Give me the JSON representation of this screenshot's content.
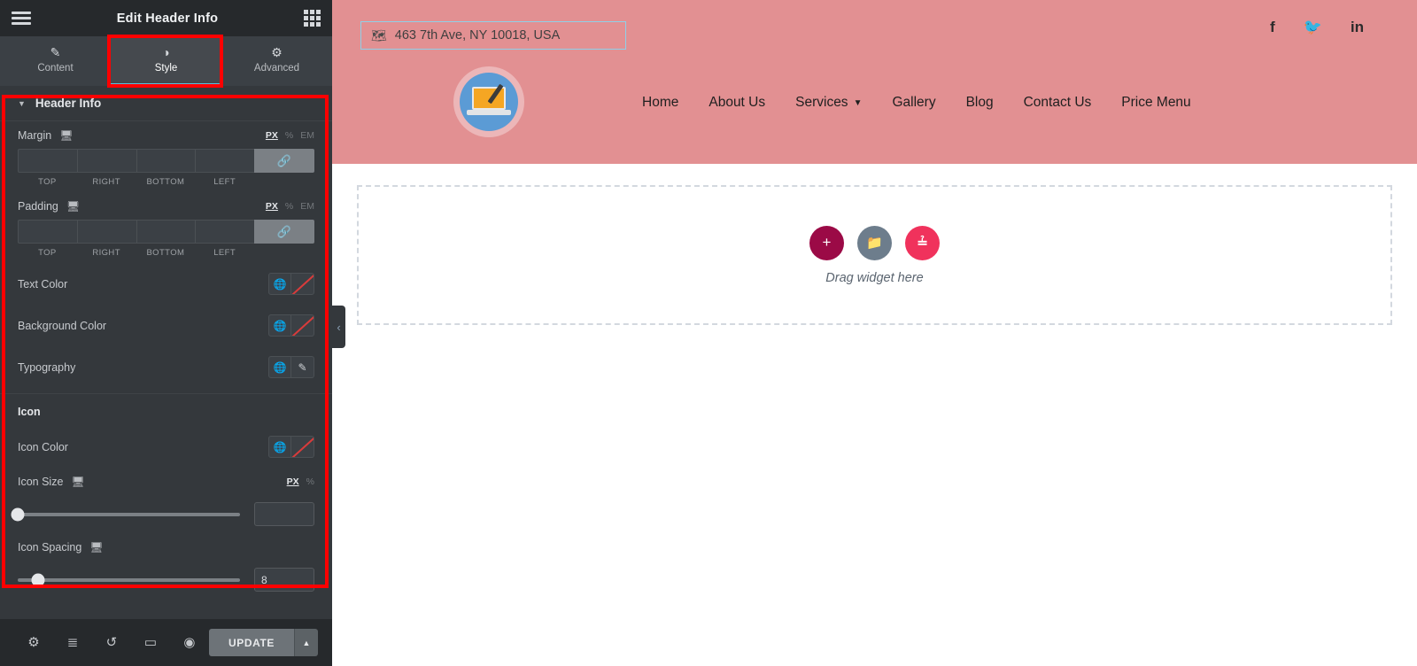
{
  "panel": {
    "header": {
      "title": "Edit Header Info",
      "menu_icon": "hamburger-icon",
      "widgets_icon": "grid-icon"
    },
    "tabs": [
      {
        "label": "Content",
        "icon": "pencil-icon",
        "active": false
      },
      {
        "label": "Style",
        "icon": "contrast-icon",
        "active": true
      },
      {
        "label": "Advanced",
        "icon": "gear-icon",
        "active": false
      }
    ],
    "section": {
      "title": "Header Info",
      "expanded": true
    },
    "margin": {
      "label": "Margin",
      "units": [
        "PX",
        "%",
        "EM"
      ],
      "active_unit": "PX",
      "fields": [
        {
          "caption": "TOP",
          "value": ""
        },
        {
          "caption": "RIGHT",
          "value": ""
        },
        {
          "caption": "BOTTOM",
          "value": ""
        },
        {
          "caption": "LEFT",
          "value": ""
        }
      ],
      "link_icon": "link-icon"
    },
    "padding": {
      "label": "Padding",
      "units": [
        "PX",
        "%",
        "EM"
      ],
      "active_unit": "PX",
      "fields": [
        {
          "caption": "TOP",
          "value": ""
        },
        {
          "caption": "RIGHT",
          "value": ""
        },
        {
          "caption": "BOTTOM",
          "value": ""
        },
        {
          "caption": "LEFT",
          "value": ""
        }
      ],
      "link_icon": "link-icon"
    },
    "text_color": {
      "label": "Text Color",
      "value": "",
      "globe_icon": "globe-icon"
    },
    "background_color": {
      "label": "Background Color",
      "value": "",
      "globe_icon": "globe-icon"
    },
    "typography": {
      "label": "Typography",
      "globe_icon": "globe-icon",
      "edit_icon": "pencil-icon"
    },
    "icon_group": {
      "title": "Icon",
      "icon_color": {
        "label": "Icon Color",
        "value": "",
        "globe_icon": "globe-icon"
      },
      "icon_size": {
        "label": "Icon Size",
        "units": [
          "PX",
          "%"
        ],
        "active_unit": "PX",
        "value": "",
        "slider_percent": 0
      },
      "icon_spacing": {
        "label": "Icon Spacing",
        "value": "8",
        "slider_percent": 9
      }
    },
    "footer": {
      "icons": [
        {
          "name": "settings-icon",
          "glyph": "⚙"
        },
        {
          "name": "navigator-icon",
          "glyph": "≣"
        },
        {
          "name": "history-icon",
          "glyph": "↺"
        },
        {
          "name": "responsive-mode-icon",
          "glyph": "▭"
        },
        {
          "name": "preview-icon",
          "glyph": "◉"
        }
      ],
      "update_label": "UPDATE",
      "update_arrow": "▲"
    },
    "collapse_icon": "‹"
  },
  "canvas": {
    "address": {
      "text": "463 7th Ave, NY 10018, USA",
      "icon": "map-icon"
    },
    "socials": [
      {
        "name": "facebook-icon",
        "glyph": "f"
      },
      {
        "name": "twitter-icon",
        "glyph": "ᵔ"
      },
      {
        "name": "linkedin-icon",
        "glyph": "in"
      }
    ],
    "logo": {
      "name": "site-logo"
    },
    "nav_items": [
      {
        "label": "Home",
        "has_dropdown": false
      },
      {
        "label": "About Us",
        "has_dropdown": false
      },
      {
        "label": "Services",
        "has_dropdown": true
      },
      {
        "label": "Gallery",
        "has_dropdown": false
      },
      {
        "label": "Blog",
        "has_dropdown": false
      },
      {
        "label": "Contact Us",
        "has_dropdown": false
      },
      {
        "label": "Price Menu",
        "has_dropdown": false
      }
    ],
    "dropzone": {
      "text": "Drag widget here",
      "buttons": [
        {
          "name": "add-section-button",
          "glyph": "+"
        },
        {
          "name": "add-template-button",
          "glyph": "▱"
        },
        {
          "name": "elementor-logo-button",
          "glyph": "≀"
        }
      ]
    },
    "header_bg": "#e29092"
  }
}
